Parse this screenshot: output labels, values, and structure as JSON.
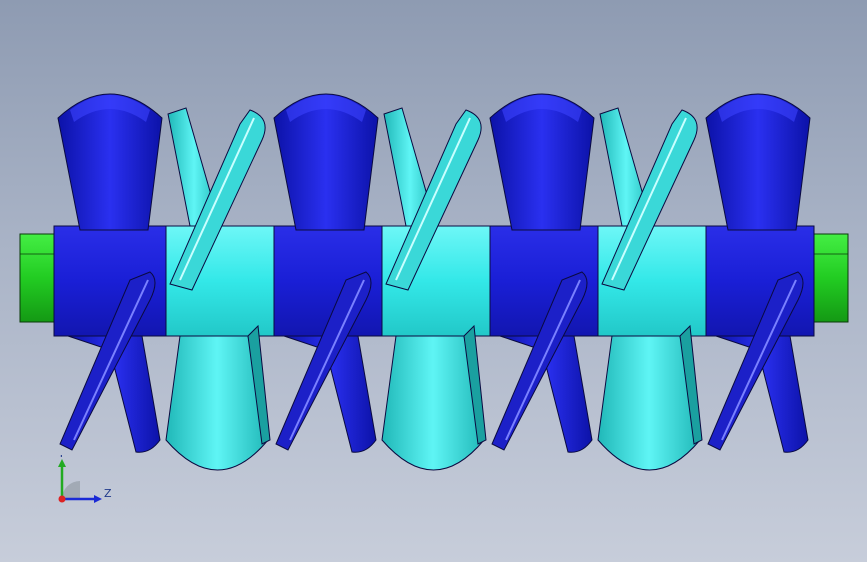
{
  "viewport": {
    "background_top": "#8e9bb2",
    "background_bottom": "#c7cdda"
  },
  "colors": {
    "blue_paddle": "#1a1fd6",
    "blue_paddle_dark": "#0c108a",
    "cyan_paddle": "#33e0e0",
    "cyan_paddle_dark": "#1aa0a0",
    "shaft_end": "#22cc22",
    "edge": "#0a0a40"
  },
  "triad": {
    "y_label": "Y",
    "z_label": "Z",
    "icons": [
      "y-axis-arrow-icon",
      "z-axis-arrow-icon",
      "origin-icon"
    ]
  }
}
